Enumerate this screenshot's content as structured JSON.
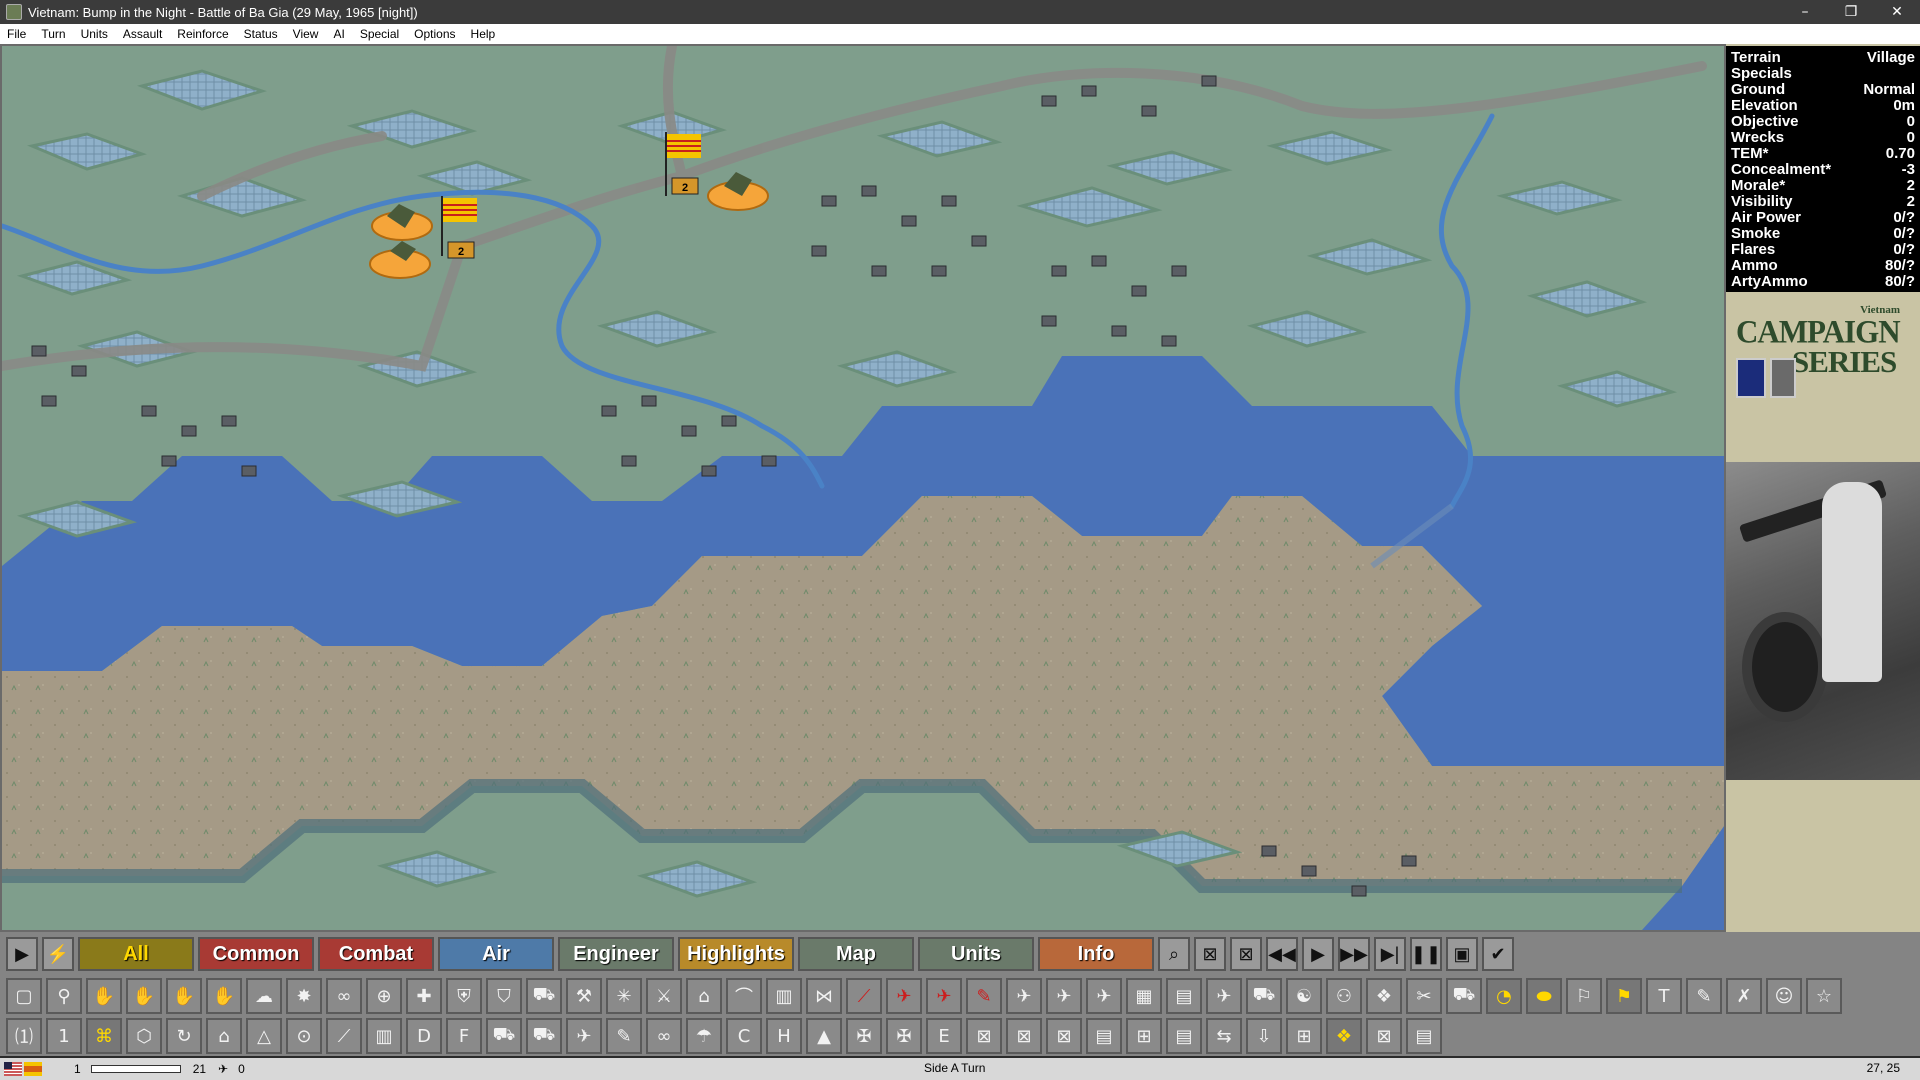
{
  "window": {
    "title": "Vietnam: Bump in the Night - Battle of Ba Gia  (29 May, 1965 [night])",
    "minimize": "–",
    "restore": "❐",
    "close": "✕"
  },
  "menu": [
    "File",
    "Turn",
    "Units",
    "Assault",
    "Reinforce",
    "Status",
    "View",
    "AI",
    "Special",
    "Options",
    "Help"
  ],
  "hex_info": [
    {
      "label": "Terrain",
      "value": "Village"
    },
    {
      "label": "Specials",
      "value": ""
    },
    {
      "label": "Ground",
      "value": "Normal"
    },
    {
      "label": "Elevation",
      "value": "0m"
    },
    {
      "label": "Objective",
      "value": "0"
    },
    {
      "label": "Wrecks",
      "value": "0"
    },
    {
      "label": "TEM*",
      "value": "0.70"
    },
    {
      "label": "Concealment*",
      "value": "-3"
    },
    {
      "label": "Morale*",
      "value": "2"
    },
    {
      "label": "Visibility",
      "value": "2"
    },
    {
      "label": "Air Power",
      "value": "0/?"
    },
    {
      "label": "Smoke",
      "value": "0/?"
    },
    {
      "label": "Flares",
      "value": "0/?"
    },
    {
      "label": "Ammo",
      "value": "80/?"
    },
    {
      "label": "ArtyAmmo",
      "value": "80/?"
    }
  ],
  "logo": {
    "line1": "Vietnam",
    "line2": "CAMPAIGN",
    "line3": "SERIES"
  },
  "map_units": [
    {
      "label": "2"
    },
    {
      "label": "2"
    }
  ],
  "toolbar_tabs": [
    {
      "label": "All",
      "color": "#8a7a1a",
      "text": "#ffd800"
    },
    {
      "label": "Common",
      "color": "#a83a34",
      "text": "#ffffff"
    },
    {
      "label": "Combat",
      "color": "#a83a34",
      "text": "#ffffff"
    },
    {
      "label": "Air",
      "color": "#4e7aa8",
      "text": "#ffffff"
    },
    {
      "label": "Engineer",
      "color": "#6a7a6a",
      "text": "#ffffff"
    },
    {
      "label": "Highlights",
      "color": "#b88a2a",
      "text": "#ffffff"
    },
    {
      "label": "Map",
      "color": "#6a7a6a",
      "text": "#ffffff"
    },
    {
      "label": "Units",
      "color": "#6a7a6a",
      "text": "#ffffff"
    },
    {
      "label": "Info",
      "color": "#b8683a",
      "text": "#ffffff"
    }
  ],
  "status": {
    "value1": "1",
    "value2": "21",
    "value3": "0",
    "center": "Side A Turn",
    "coords": "27, 25"
  },
  "colors": {
    "river": "#4a72b8",
    "grass": "#7f9e8c",
    "sand": "#a59a86",
    "rice_paddy": "#8fb0c9",
    "unit_disc": "#f5a53a"
  }
}
